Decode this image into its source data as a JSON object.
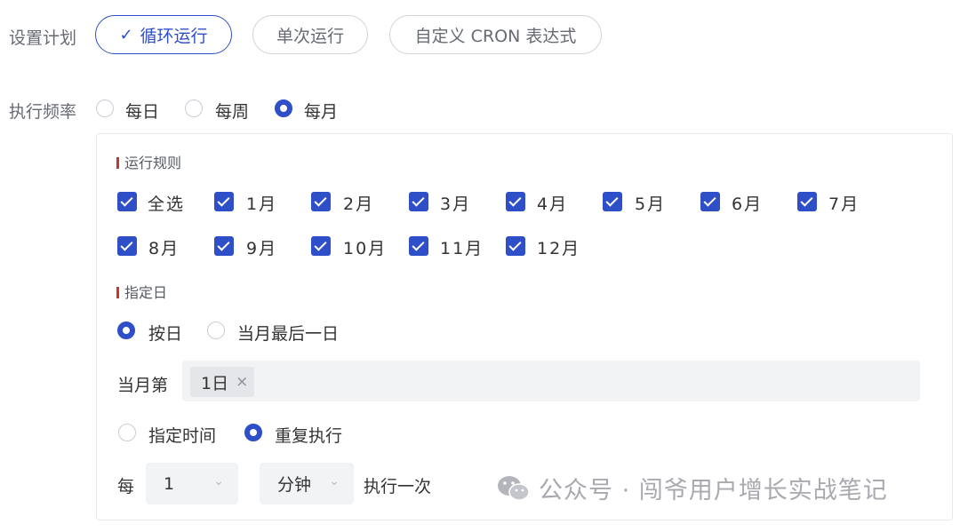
{
  "schedule": {
    "label": "设置计划",
    "options": [
      {
        "label": "循环运行",
        "check": "✓"
      },
      {
        "label": "单次运行"
      },
      {
        "label": "自定义 CRON 表达式"
      }
    ]
  },
  "frequency": {
    "label": "执行频率",
    "options": [
      "每日",
      "每周",
      "每月"
    ],
    "selected": "每月"
  },
  "rules": {
    "title": "运行规则",
    "checkboxes": [
      "全选",
      "1月",
      "2月",
      "3月",
      "4月",
      "5月",
      "6月",
      "7月",
      "8月",
      "9月",
      "10月",
      "11月",
      "12月"
    ]
  },
  "specified_day": {
    "title": "指定日",
    "options": [
      "按日",
      "当月最后一日"
    ],
    "selected": "按日",
    "month_label": "当月第",
    "tag_value": "1日",
    "tag_remove": "×"
  },
  "time_mode": {
    "options": [
      "指定时间",
      "重复执行"
    ],
    "selected": "重复执行"
  },
  "repeat": {
    "every_label": "每",
    "interval_value": "1",
    "unit_value": "分钟",
    "suffix": "执行一次"
  },
  "watermark": {
    "text": "公众号 · 闯爷用户增长实战笔记"
  },
  "colors": {
    "accent": "#2f4fc9",
    "section_bar": "#c0392b"
  }
}
